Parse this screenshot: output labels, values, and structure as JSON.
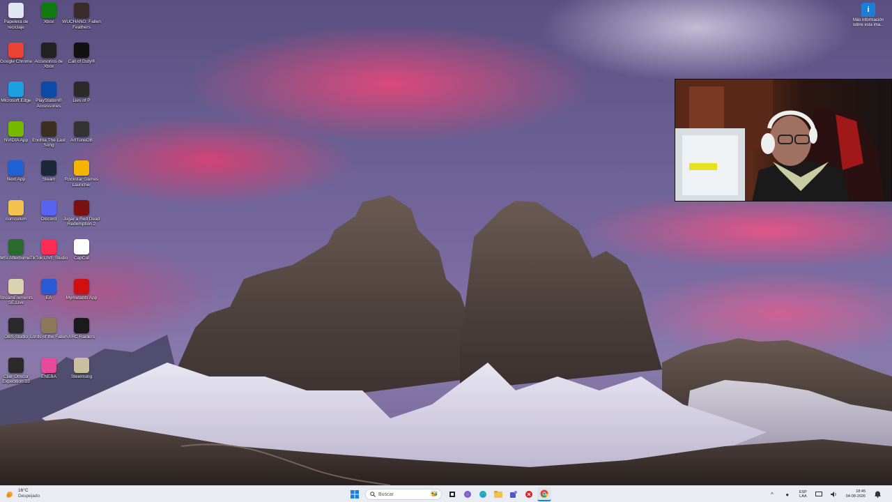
{
  "desktop": {
    "icons": [
      {
        "label": "Papelera de reciclaje",
        "icon": "recycle-bin-icon",
        "color": "#dfe8f2"
      },
      {
        "label": "Xbox",
        "icon": "xbox-icon",
        "color": "#107c10"
      },
      {
        "label": "WUCHANG: Fallen Feathers",
        "icon": "game-icon",
        "color": "#3a2a2a"
      },
      {
        "label": "Google Chrome",
        "icon": "chrome-icon",
        "color": "#ea4335"
      },
      {
        "label": "Accesorios de Xbox",
        "icon": "xbox-controller-icon",
        "color": "#222222"
      },
      {
        "label": "Call of Duty®",
        "icon": "game-icon",
        "color": "#111111"
      },
      {
        "label": "Microsoft Edge",
        "icon": "edge-icon",
        "color": "#1ba1e2"
      },
      {
        "label": "PlayStation® Accessories",
        "icon": "playstation-icon",
        "color": "#0a4aa8"
      },
      {
        "label": "Lies of P",
        "icon": "game-icon",
        "color": "#2a2a2a"
      },
      {
        "label": "NVIDIA App",
        "icon": "nvidia-icon",
        "color": "#76b900"
      },
      {
        "label": "Enotria The Last Song",
        "icon": "game-icon",
        "color": "#3b3020"
      },
      {
        "label": "ArtTuneDB",
        "icon": "app-icon",
        "color": "#333333"
      },
      {
        "label": "Next App",
        "icon": "app-icon",
        "color": "#1e63d6"
      },
      {
        "label": "Steam",
        "icon": "steam-icon",
        "color": "#1b2838"
      },
      {
        "label": "Rockstar Games Launcher",
        "icon": "rockstar-icon",
        "color": "#f4b400"
      },
      {
        "label": "curriculum",
        "icon": "folder-icon",
        "color": "#f2c14e"
      },
      {
        "label": "Discord",
        "icon": "discord-icon",
        "color": "#5865f2"
      },
      {
        "label": "Jugar a Red Dead Redemption 2",
        "icon": "game-icon",
        "color": "#7a1010"
      },
      {
        "label": "MSI Afterburner",
        "icon": "afterburner-icon",
        "color": "#2a6a2a"
      },
      {
        "label": "TikTok LIVE Studio",
        "icon": "tiktok-icon",
        "color": "#fe2c55"
      },
      {
        "label": "CapCut",
        "icon": "capcut-icon",
        "color": "#ffffff"
      },
      {
        "label": "StreamElements SE.Live",
        "icon": "streamelements-icon",
        "color": "#d9d2b0"
      },
      {
        "label": "EA",
        "icon": "ea-icon",
        "color": "#2a5ad6"
      },
      {
        "label": "Mymutants App",
        "icon": "app-icon",
        "color": "#d01010"
      },
      {
        "label": "OBS Studio",
        "icon": "obs-icon",
        "color": "#2a2a2a"
      },
      {
        "label": "Lords of the Fallen",
        "icon": "game-icon",
        "color": "#8a7a5a"
      },
      {
        "label": "ARC Raiders",
        "icon": "game-icon",
        "color": "#1a1a1a"
      },
      {
        "label": "Clair Obscur Expedition 33",
        "icon": "game-icon",
        "color": "#2a2a2a"
      },
      {
        "label": "ENEBA",
        "icon": "eneba-icon",
        "color": "#e64a9a"
      },
      {
        "label": "Steelrising",
        "icon": "game-icon",
        "color": "#c8c0a0"
      }
    ],
    "info_icon_label": "Más información sobre esta ima..."
  },
  "taskbar": {
    "weather_temp": "16°C",
    "weather_desc": "Despejado",
    "search_placeholder": "Buscar",
    "lang_top": "ESP",
    "lang_bottom": "LAA",
    "time": "18:45",
    "date": "04-08-2026"
  }
}
